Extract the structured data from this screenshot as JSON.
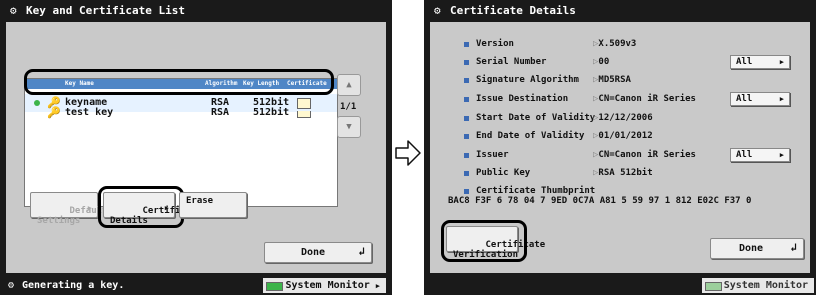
{
  "left": {
    "title": "Key and Certificate List",
    "columns": [
      "Key Name",
      "Algorithm",
      "Key Length",
      "Certificate"
    ],
    "rows": [
      {
        "name": "keyname",
        "algorithm": "RSA",
        "length": "512bit"
      },
      {
        "name": "test key",
        "algorithm": "RSA",
        "length": "512bit"
      }
    ],
    "page_indicator": "1/1",
    "buttons": {
      "default_key": "Default Key\nSettings",
      "cert_details": "Certificate\nDetails",
      "erase": "Erase",
      "done": "Done"
    },
    "status": "Generating a key.",
    "system_monitor": "System Monitor"
  },
  "right": {
    "title": "Certificate Details",
    "fields": [
      {
        "label": "Version",
        "value": "X.509v3"
      },
      {
        "label": "Serial Number",
        "value": "00"
      },
      {
        "label": "Signature Algorithm",
        "value": "MD5RSA"
      },
      {
        "label": "Issue Destination",
        "value": "CN=Canon iR Series"
      },
      {
        "label": "Start Date of Validity",
        "value": "12/12/2006"
      },
      {
        "label": "End Date of Validity",
        "value": "01/01/2012"
      },
      {
        "label": "Issuer",
        "value": "CN=Canon iR Series"
      },
      {
        "label": "Public Key",
        "value": "RSA  512bit"
      }
    ],
    "all_label": "All",
    "thumbprint_label": "Certificate Thumbprint",
    "thumbprint_value": "BAC8  F3F 6 78 04 7 9ED  0C7A  A81 5 59 97 1 812  E02C  F37 0",
    "buttons": {
      "verification": "Certificate\nVerification",
      "done": "Done"
    },
    "system_monitor": "System Monitor"
  }
}
